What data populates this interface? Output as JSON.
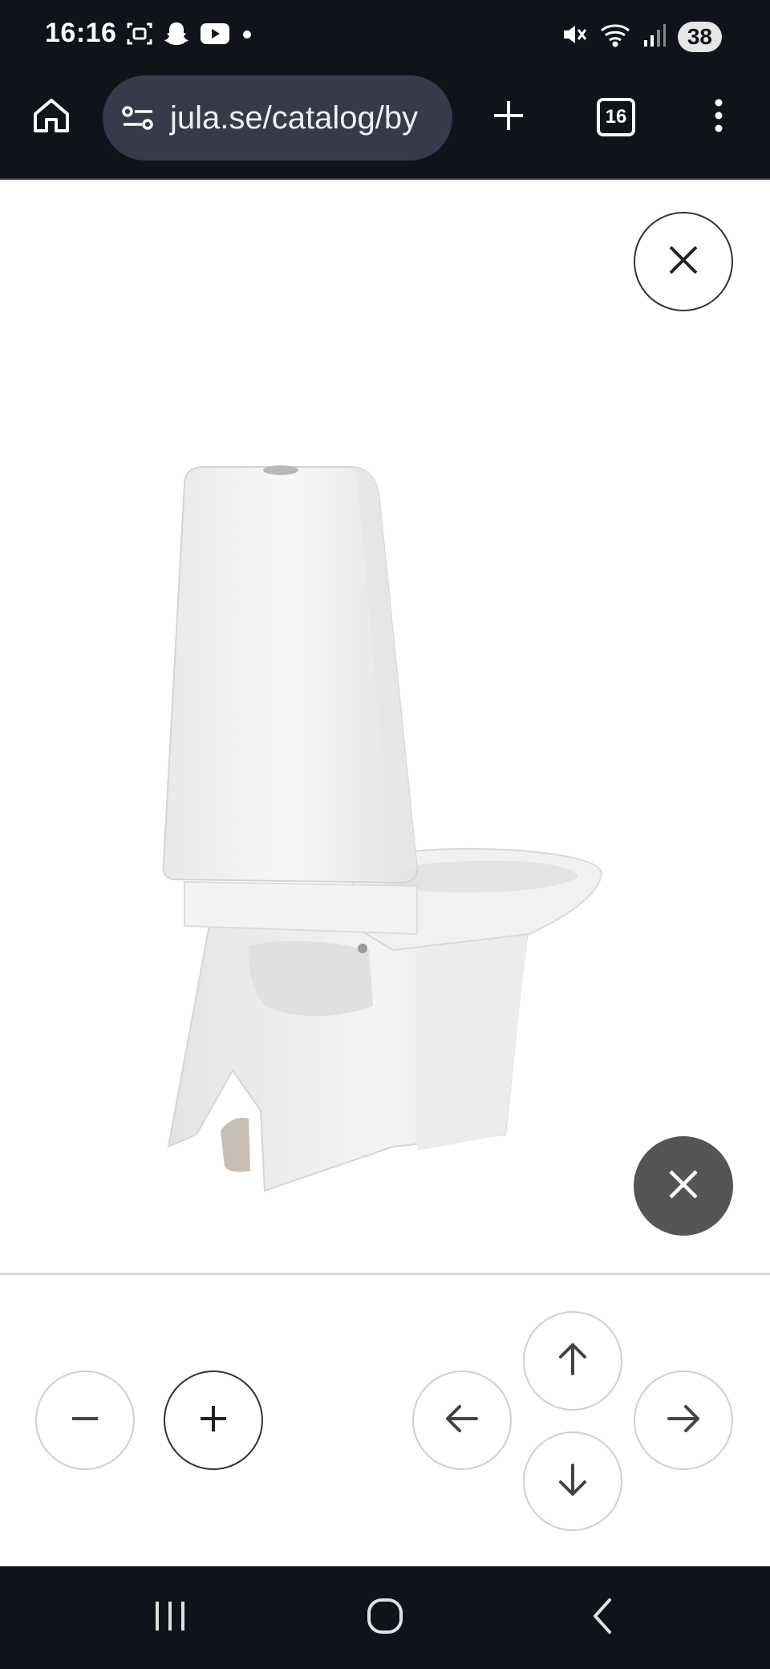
{
  "status_bar": {
    "time": "16:16",
    "battery": "38",
    "icons_left": [
      "screenshot-icon",
      "snapchat-icon",
      "youtube-icon",
      "dot-icon"
    ],
    "icons_right": [
      "mute-icon",
      "wifi-icon",
      "signal-icon"
    ]
  },
  "browser": {
    "url": "jula.se/catalog/by",
    "tab_count": "16",
    "icons": [
      "home-icon",
      "site-settings-icon",
      "new-tab-icon",
      "tab-switcher-icon",
      "more-menu-icon"
    ]
  },
  "viewer": {
    "image": "white toilet product image",
    "controls": [
      "close",
      "zoom-out",
      "zoom-in",
      "pan-up",
      "pan-left",
      "pan-right",
      "pan-down"
    ]
  },
  "system_nav": {
    "buttons": [
      "recents",
      "home",
      "back"
    ]
  },
  "colors": {
    "system_bar_bg": "#11131a",
    "url_pill_bg": "#363a4a",
    "dark_close_bg": "#555555"
  }
}
